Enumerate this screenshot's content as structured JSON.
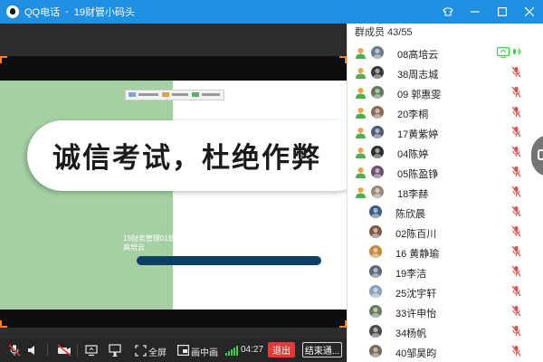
{
  "window": {
    "app_name": "QQ电话",
    "separator": "-",
    "group_name": "19财管小码头"
  },
  "slide": {
    "title": "诚信考试，杜绝作弊",
    "subtitle_line1": "19财务管理01班",
    "subtitle_line2": "高培云",
    "colors": {
      "green": "#a5d0a4",
      "bar": "#0c3f66"
    }
  },
  "toolbar": {
    "fullscreen_label": "全屏",
    "pip_label": "画中画",
    "timer": "04:27",
    "quit_label": "退出",
    "end_label": "结束通..."
  },
  "members": {
    "header": "群成员 43/55",
    "list": [
      {
        "name": "08高培云",
        "owner": true,
        "status": "speaking"
      },
      {
        "name": "38周志城",
        "owner": true,
        "status": "muted"
      },
      {
        "name": "09 郭惠雯",
        "owner": true,
        "status": "muted"
      },
      {
        "name": "20李桐",
        "owner": true,
        "status": "muted"
      },
      {
        "name": "17黄紫婷",
        "owner": true,
        "status": "muted"
      },
      {
        "name": "04陈婷",
        "owner": true,
        "status": "muted"
      },
      {
        "name": "05陈盈铮",
        "owner": true,
        "status": "muted"
      },
      {
        "name": "18李赫",
        "owner": true,
        "status": "muted"
      },
      {
        "name": "陈欣晨",
        "owner": false,
        "status": "muted"
      },
      {
        "name": "02陈百川",
        "owner": false,
        "status": "muted"
      },
      {
        "name": "16 黄静瑜",
        "owner": false,
        "status": "muted"
      },
      {
        "name": "19李洁",
        "owner": false,
        "status": "muted"
      },
      {
        "name": "25沈宇轩",
        "owner": false,
        "status": "muted"
      },
      {
        "name": "33许申怡",
        "owner": false,
        "status": "muted"
      },
      {
        "name": "34杨帆",
        "owner": false,
        "status": "muted"
      },
      {
        "name": "40邹昊昀",
        "owner": false,
        "status": "muted"
      }
    ]
  },
  "colors": {
    "titlebar": "#1e8fe1",
    "mute_red": "#d9534f",
    "speaking_green": "#3ecf4a",
    "quit_red": "#e23a3a"
  },
  "icons": {
    "window": [
      "qq-logo-icon",
      "skin-icon",
      "minimize-icon",
      "maximize-icon",
      "close-icon"
    ],
    "toolbar": [
      "mic-off-icon",
      "speaker-icon",
      "camera-off-icon",
      "screen-share-icon",
      "presenter-icon",
      "fullscreen-icon",
      "pip-icon",
      "signal-icon"
    ],
    "members": [
      "member-user-icon",
      "avatar-icon",
      "mic-muted-icon",
      "screen-sharing-icon",
      "speaking-icon"
    ]
  }
}
